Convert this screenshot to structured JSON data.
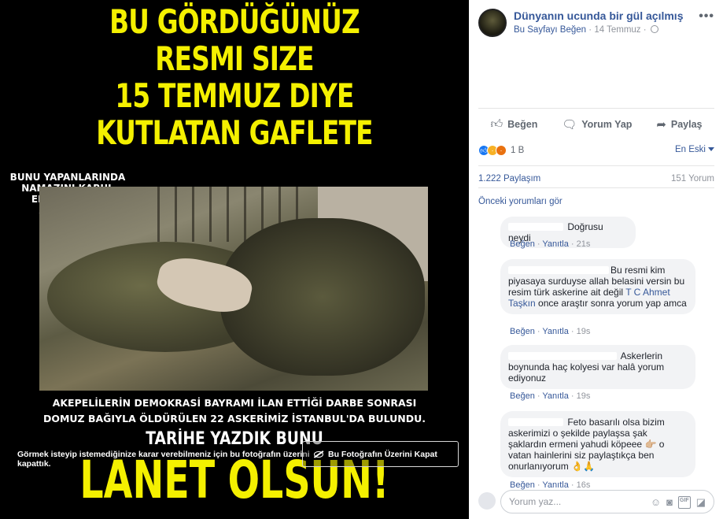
{
  "image": {
    "headline_lines": [
      "BU GÖRDÜĞÜNÜZ",
      "RESMI SIZE",
      "15 TEMMUZ DIYE",
      "KUTLATAN GAFLETE"
    ],
    "caption_top": "BUNU YAPANLARINDA NAMAZINI KABUL EDECEKMİSİN ALLAH'IM .",
    "caption_bottom_1": "AKEPELİLERİN DEMOKRASİ BAYRAMI İLAN ETTİĞİ DARBE SONRASI",
    "caption_bottom_2": "DOMUZ BAĞIYLA ÖLDÜRÜLEN 22 ASKERİMİZ İSTANBUL'DA BULUNDU.",
    "tarihe": "TARİHE YAZDIK BUNU",
    "lanet": "LANET OLSUN!"
  },
  "overlay": {
    "warning_text": "Görmek isteyip istemediğinize karar verebilmeniz için bu fotoğrafın üzerini kapattık.",
    "uncover_button": "Bu Fotoğrafın Üzerini Kapat"
  },
  "post": {
    "page_name": "Dünyanın ucunda bir gül açılmış",
    "like_page": "Bu Sayfayı Beğen",
    "separator": "·",
    "date": "14 Temmuz",
    "more": "•••"
  },
  "actions": {
    "like": "Beğen",
    "comment": "Yorum Yap",
    "share": "Paylaş"
  },
  "reactions": {
    "count": "1 B",
    "sort": "En Eski"
  },
  "stats": {
    "shares": "1.222 Paylaşım",
    "comments": "151 Yorum"
  },
  "previous_comments": "Önceki yorumları gör",
  "comments": [
    {
      "text": "Doğrusu neydi",
      "like": "Beğen",
      "reply": "Yanıtla",
      "time": "21s"
    },
    {
      "text_before": "Bu resmi kim piyasaya surduyse allah belasini versin bu resim türk askerine ait değil ",
      "mention": "T C Ahmet Taşkın",
      "text_after": " once araştır sonra yorum yap amca",
      "like": "Beğen",
      "reply": "Yanıtla",
      "time": "19s"
    },
    {
      "text": "Askerlerin boynunda haç kolyesi var halâ yorum ediyonuz",
      "like": "Beğen",
      "reply": "Yanıtla",
      "time": "19s"
    },
    {
      "text": "Feto basarılı olsa bizim askerimizi o şekilde paylaşsa şak şaklardın ermeni yahudi köpeee 👉🏼 o vatan hainlerini siz paylaştıkça ben onurlanıyorum 👌🙏",
      "like": "Beğen",
      "reply": "Yanıtla",
      "time": "16s"
    }
  ],
  "compose": {
    "placeholder": "Yorum yaz..."
  },
  "colors": {
    "link": "#365899",
    "headline_yellow": "#f4f000",
    "bubble": "#f2f3f5"
  }
}
